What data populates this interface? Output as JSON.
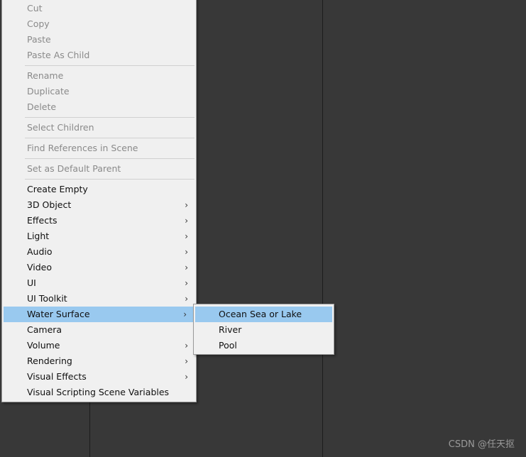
{
  "context_menu": {
    "groups": [
      [
        {
          "label": "Cut",
          "disabled": true
        },
        {
          "label": "Copy",
          "disabled": true
        },
        {
          "label": "Paste",
          "disabled": true
        },
        {
          "label": "Paste As Child",
          "disabled": true
        }
      ],
      [
        {
          "label": "Rename",
          "disabled": true
        },
        {
          "label": "Duplicate",
          "disabled": true
        },
        {
          "label": "Delete",
          "disabled": true
        }
      ],
      [
        {
          "label": "Select Children",
          "disabled": true
        }
      ],
      [
        {
          "label": "Find References in Scene",
          "disabled": true
        }
      ],
      [
        {
          "label": "Set as Default Parent",
          "disabled": true
        }
      ],
      [
        {
          "label": "Create Empty",
          "submenu": false
        },
        {
          "label": "3D Object",
          "submenu": true
        },
        {
          "label": "Effects",
          "submenu": true
        },
        {
          "label": "Light",
          "submenu": true
        },
        {
          "label": "Audio",
          "submenu": true
        },
        {
          "label": "Video",
          "submenu": true
        },
        {
          "label": "UI",
          "submenu": true
        },
        {
          "label": "UI Toolkit",
          "submenu": true
        },
        {
          "label": "Water Surface",
          "submenu": true,
          "highlighted": true
        },
        {
          "label": "Camera",
          "submenu": false
        },
        {
          "label": "Volume",
          "submenu": true
        },
        {
          "label": "Rendering",
          "submenu": true
        },
        {
          "label": "Visual Effects",
          "submenu": true
        },
        {
          "label": "Visual Scripting Scene Variables",
          "submenu": false
        }
      ]
    ]
  },
  "water_surface_submenu": {
    "items": [
      {
        "label": "Ocean Sea or Lake",
        "highlighted": true
      },
      {
        "label": "River"
      },
      {
        "label": "Pool"
      }
    ]
  },
  "watermark": "CSDN @任天抠",
  "colors": {
    "menu_bg": "#f0f0f0",
    "highlight": "#99c9ef",
    "disabled_text": "#8a8a8a",
    "editor_bg": "#383838"
  }
}
